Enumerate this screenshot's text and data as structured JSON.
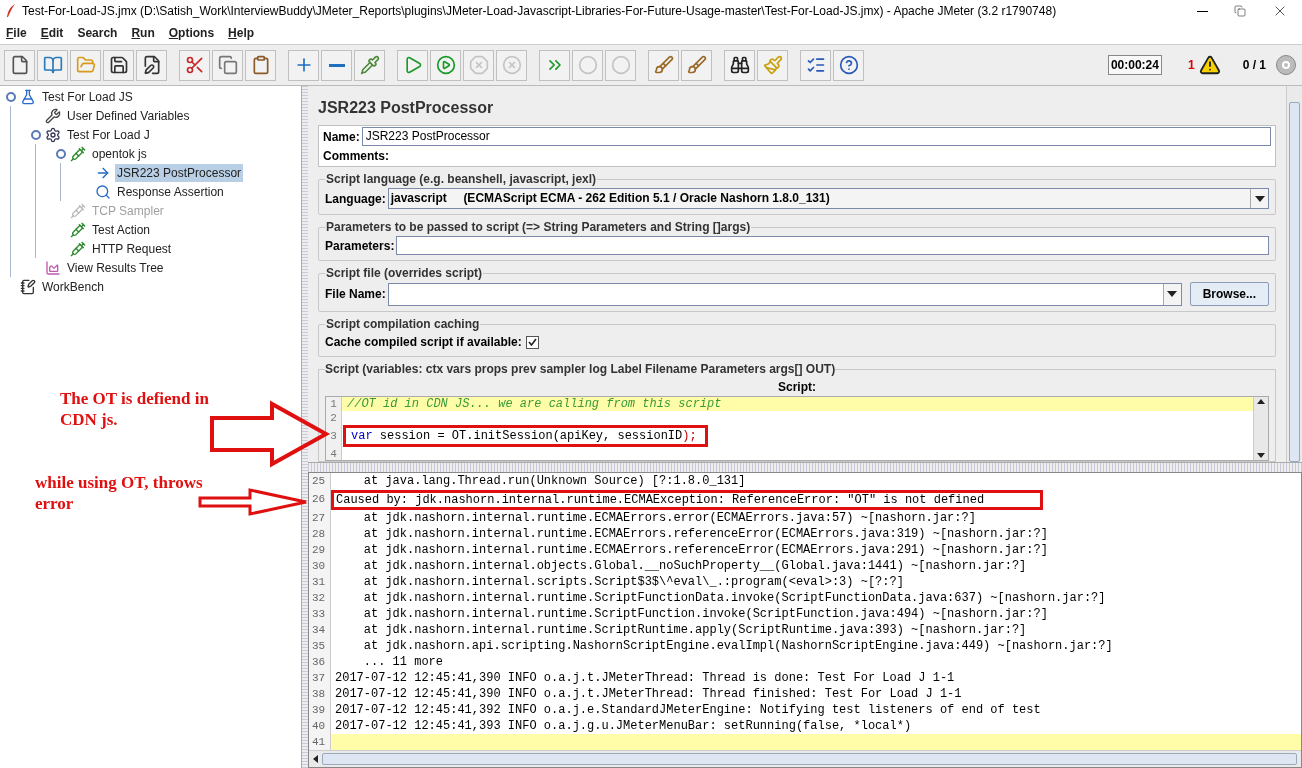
{
  "window": {
    "title": "Test-For-Load-JS.jmx (D:\\Satish_Work\\InterviewBuddy\\JMeter_Reports\\plugins\\JMeter-Load-Javascript-Libraries-For-Future-Usage-master\\Test-For-Load-JS.jmx) - Apache JMeter (3.2 r1790748)"
  },
  "menu": [
    {
      "label": "File",
      "mnemonic": true
    },
    {
      "label": "Edit",
      "mnemonic": true
    },
    {
      "label": "Search",
      "mnemonic": false
    },
    {
      "label": "Run",
      "mnemonic": true
    },
    {
      "label": "Options",
      "mnemonic": true
    },
    {
      "label": "Help",
      "mnemonic": true
    }
  ],
  "toolbar": [
    [
      {
        "kind": "new",
        "disabled": false
      },
      {
        "kind": "templates",
        "disabled": false
      },
      {
        "kind": "open",
        "disabled": false
      },
      {
        "kind": "save",
        "disabled": false
      },
      {
        "kind": "saveas",
        "disabled": false
      }
    ],
    [
      {
        "kind": "cut",
        "disabled": false
      },
      {
        "kind": "copy",
        "disabled": false
      },
      {
        "kind": "paste",
        "disabled": false
      }
    ],
    [
      {
        "kind": "expand",
        "disabled": false
      },
      {
        "kind": "collapse",
        "disabled": false
      },
      {
        "kind": "toggle",
        "disabled": false
      }
    ],
    [
      {
        "kind": "start",
        "disabled": false
      },
      {
        "kind": "startnopause",
        "disabled": false
      },
      {
        "kind": "stop",
        "disabled": true
      },
      {
        "kind": "shutdown",
        "disabled": true
      }
    ],
    [
      {
        "kind": "remotestart",
        "disabled": false
      },
      {
        "kind": "remotestop",
        "disabled": true
      },
      {
        "kind": "remoteexit",
        "disabled": true
      }
    ],
    [
      {
        "kind": "clear",
        "disabled": false
      },
      {
        "kind": "clearall",
        "disabled": false
      }
    ],
    [
      {
        "kind": "search",
        "disabled": false
      },
      {
        "kind": "resetsearch",
        "disabled": false
      }
    ],
    [
      {
        "kind": "functions",
        "disabled": false
      },
      {
        "kind": "help",
        "disabled": false
      }
    ]
  ],
  "status": {
    "timer": "00:00:24",
    "errors": "1",
    "threads": "0 / 1"
  },
  "tree": [
    {
      "label": "Test For Load JS",
      "kind": "plan",
      "selected": false,
      "disabled": false,
      "children": [
        {
          "label": "User Defined Variables",
          "kind": "config",
          "selected": false,
          "disabled": false
        },
        {
          "label": "Test For Load J",
          "kind": "threads",
          "selected": false,
          "disabled": false,
          "children": [
            {
              "label": "opentok js",
              "kind": "sampler",
              "selected": false,
              "disabled": false,
              "children": [
                {
                  "label": "JSR223 PostProcessor",
                  "kind": "post",
                  "selected": true,
                  "disabled": false
                },
                {
                  "label": "Response Assertion",
                  "kind": "assertion",
                  "selected": false,
                  "disabled": false
                }
              ]
            },
            {
              "label": "TCP Sampler",
              "kind": "sampler",
              "selected": false,
              "disabled": true
            },
            {
              "label": "Test Action",
              "kind": "sampler",
              "selected": false,
              "disabled": false
            },
            {
              "label": "HTTP Request",
              "kind": "sampler",
              "selected": false,
              "disabled": false
            }
          ]
        },
        {
          "label": "View Results Tree",
          "kind": "listener",
          "selected": false,
          "disabled": false
        }
      ]
    },
    {
      "label": "WorkBench",
      "kind": "workbench",
      "selected": false,
      "disabled": false
    }
  ],
  "editor": {
    "title": "JSR223 PostProcessor",
    "name_label": "Name:",
    "name_value": "JSR223 PostProcessor",
    "comments_label": "Comments:",
    "language_legend": "Script language (e.g. beanshell, javascript, jexl)",
    "language_label": "Language:",
    "language_value": "javascript     (ECMAScript ECMA - 262 Edition 5.1 / Oracle Nashorn 1.8.0_131)",
    "parameters_legend": "Parameters to be passed to script (=> String Parameters and String []args)",
    "parameters_label": "Parameters:",
    "file_legend": "Script file (overrides script)",
    "file_label": "File Name:",
    "browse": "Browse...",
    "cache_legend": "Script compilation caching",
    "cache_label": "Cache compiled script if available:",
    "cache_checked": true,
    "script_legend": "Script (variables: ctx vars props prev sampler log Label Filename Parameters args[] OUT)",
    "script_label": "Script:",
    "script_lines": [
      {
        "number": "1",
        "highlighted": true,
        "boxed": false,
        "tokens": [
          {
            "kind": "comment",
            "text": "//OT id in CDN JS... we are calling from this script"
          }
        ]
      },
      {
        "number": "2",
        "highlighted": false,
        "boxed": false
      },
      {
        "number": "3",
        "highlighted": false,
        "boxed": true,
        "tokens": [
          {
            "kind": "keyword",
            "text": "var"
          },
          {
            "kind": "plain",
            "text": " session = OT.initSession(apiKey, sessionID"
          },
          {
            "kind": "paren",
            "text": ");"
          }
        ]
      },
      {
        "number": "4",
        "highlighted": false,
        "boxed": false
      }
    ]
  },
  "log": [
    {
      "number": "25",
      "text": "    at java.lang.Thread.run(Unknown Source) [?:1.8.0_131]",
      "highlighted": false,
      "boxed": false
    },
    {
      "number": "26",
      "text": "Caused by: jdk.nashorn.internal.runtime.ECMAException: ReferenceError: \"OT\" is not defined",
      "highlighted": false,
      "boxed": true
    },
    {
      "number": "27",
      "text": "    at jdk.nashorn.internal.runtime.ECMAErrors.error(ECMAErrors.java:57) ~[nashorn.jar:?]",
      "highlighted": false,
      "boxed": false
    },
    {
      "number": "28",
      "text": "    at jdk.nashorn.internal.runtime.ECMAErrors.referenceError(ECMAErrors.java:319) ~[nashorn.jar:?]",
      "highlighted": false,
      "boxed": false
    },
    {
      "number": "29",
      "text": "    at jdk.nashorn.internal.runtime.ECMAErrors.referenceError(ECMAErrors.java:291) ~[nashorn.jar:?]",
      "highlighted": false,
      "boxed": false
    },
    {
      "number": "30",
      "text": "    at jdk.nashorn.internal.objects.Global.__noSuchProperty__(Global.java:1441) ~[nashorn.jar:?]",
      "highlighted": false,
      "boxed": false
    },
    {
      "number": "31",
      "text": "    at jdk.nashorn.internal.scripts.Script$3$\\^eval\\_.:program(<eval>:3) ~[?:?]",
      "highlighted": false,
      "boxed": false
    },
    {
      "number": "32",
      "text": "    at jdk.nashorn.internal.runtime.ScriptFunctionData.invoke(ScriptFunctionData.java:637) ~[nashorn.jar:?]",
      "highlighted": false,
      "boxed": false
    },
    {
      "number": "33",
      "text": "    at jdk.nashorn.internal.runtime.ScriptFunction.invoke(ScriptFunction.java:494) ~[nashorn.jar:?]",
      "highlighted": false,
      "boxed": false
    },
    {
      "number": "34",
      "text": "    at jdk.nashorn.internal.runtime.ScriptRuntime.apply(ScriptRuntime.java:393) ~[nashorn.jar:?]",
      "highlighted": false,
      "boxed": false
    },
    {
      "number": "35",
      "text": "    at jdk.nashorn.api.scripting.NashornScriptEngine.evalImpl(NashornScriptEngine.java:449) ~[nashorn.jar:?]",
      "highlighted": false,
      "boxed": false
    },
    {
      "number": "36",
      "text": "    ... 11 more",
      "highlighted": false,
      "boxed": false
    },
    {
      "number": "37",
      "text": "2017-07-12 12:45:41,390 INFO o.a.j.t.JMeterThread: Thread is done: Test For Load J 1-1",
      "highlighted": false,
      "boxed": false
    },
    {
      "number": "38",
      "text": "2017-07-12 12:45:41,390 INFO o.a.j.t.JMeterThread: Thread finished: Test For Load J 1-1",
      "highlighted": false,
      "boxed": false
    },
    {
      "number": "39",
      "text": "2017-07-12 12:45:41,392 INFO o.a.j.e.StandardJMeterEngine: Notifying test listeners of end of test",
      "highlighted": false,
      "boxed": false
    },
    {
      "number": "40",
      "text": "2017-07-12 12:45:41,393 INFO o.a.j.g.u.JMeterMenuBar: setRunning(false, *local*)",
      "highlighted": false,
      "boxed": false
    },
    {
      "number": "41",
      "highlighted": true,
      "boxed": false
    }
  ],
  "annotations": [
    {
      "text": "The OT is defiend in CDN js."
    },
    {
      "text": "while using OT, throws error"
    }
  ]
}
